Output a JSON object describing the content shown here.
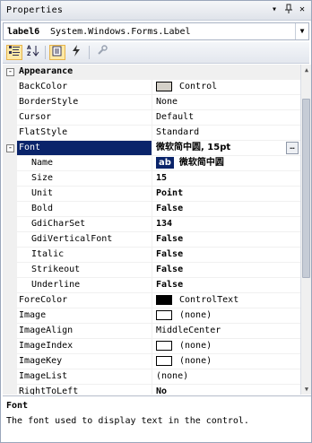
{
  "window": {
    "title": "Properties",
    "pin_glyph": "▾",
    "autohide_glyph": "⊥",
    "close_glyph": "✕"
  },
  "object_selector": {
    "name": "label6",
    "type": "System.Windows.Forms.Label"
  },
  "toolbar": {
    "buttons": [
      {
        "name": "categorized",
        "icon": "categorized-icon",
        "active": true
      },
      {
        "name": "alphabetical",
        "icon": "alphabetical-icon",
        "active": false
      },
      {
        "name": "properties",
        "icon": "properties-icon",
        "active": true
      },
      {
        "name": "events",
        "icon": "events-lightning-icon",
        "active": false
      },
      {
        "name": "property-pages",
        "icon": "wrench-icon",
        "active": false
      }
    ]
  },
  "grid": {
    "category": {
      "label": "Appearance",
      "expander": "-"
    },
    "rows": [
      {
        "name": "BackColor",
        "value": "Control",
        "swatch": "#d4d0c8"
      },
      {
        "name": "BorderStyle",
        "value": "None"
      },
      {
        "name": "Cursor",
        "value": "Default"
      },
      {
        "name": "FlatStyle",
        "value": "Standard"
      }
    ],
    "font_row": {
      "name": "Font",
      "value": "微软简中圆, 15pt",
      "expander": "-"
    },
    "font_subrows": [
      {
        "name": "Name",
        "value": "微软简中圆",
        "badge": "ab"
      },
      {
        "name": "Size",
        "value": "15",
        "bold": true
      },
      {
        "name": "Unit",
        "value": "Point",
        "bold": true
      },
      {
        "name": "Bold",
        "value": "False",
        "bold": true
      },
      {
        "name": "GdiCharSet",
        "value": "134",
        "bold": true
      },
      {
        "name": "GdiVerticalFont",
        "value": "False",
        "bold": true
      },
      {
        "name": "Italic",
        "value": "False",
        "bold": true
      },
      {
        "name": "Strikeout",
        "value": "False",
        "bold": true
      },
      {
        "name": "Underline",
        "value": "False",
        "bold": true
      }
    ],
    "rows_after": [
      {
        "name": "ForeColor",
        "value": "ControlText",
        "swatch": "#000000"
      },
      {
        "name": "Image",
        "value": "(none)",
        "swatch": "#ffffff"
      },
      {
        "name": "ImageAlign",
        "value": "MiddleCenter"
      },
      {
        "name": "ImageIndex",
        "value": "(none)",
        "swatch": "#ffffff"
      },
      {
        "name": "ImageKey",
        "value": "(none)",
        "swatch": "#ffffff"
      },
      {
        "name": "ImageList",
        "value": "(none)"
      },
      {
        "name": "RightToLeft",
        "value": "No",
        "bold": true
      }
    ]
  },
  "description": {
    "title": "Font",
    "text": "The font used to display text in the control."
  },
  "colors": {
    "selection": "#0a246a",
    "gutter": "#f0f0f0",
    "toolbar_active": "#fde9a6"
  }
}
